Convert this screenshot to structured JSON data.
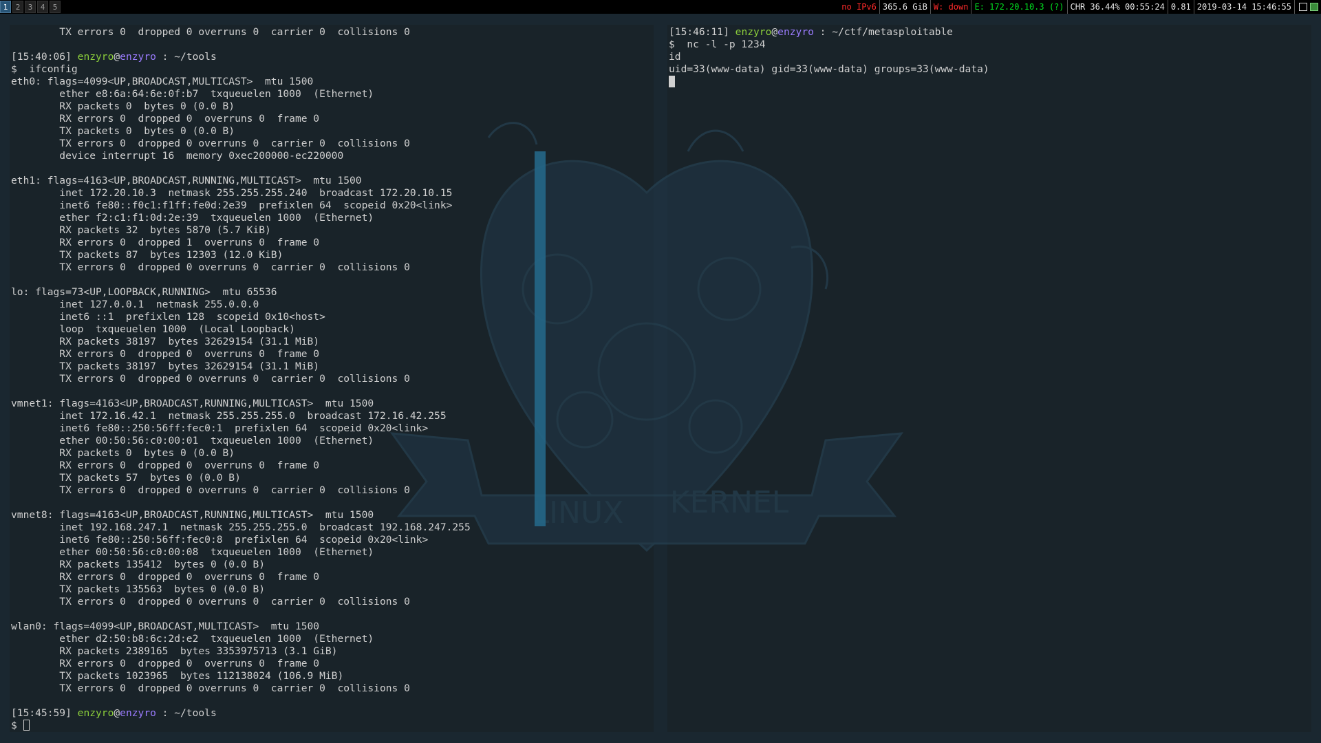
{
  "taskbar": {
    "workspaces": [
      "1",
      "2",
      "3",
      "4",
      "5"
    ],
    "active_workspace": "1",
    "status": {
      "ipv6": "no IPv6",
      "disk": "365.6 GiB",
      "wifi": "W: down",
      "ethernet": "E: 172.20.10.3 (?)",
      "battery": "CHR 36.44% 00:55:24",
      "load": "0.81",
      "datetime": "2019-03-14 15:46:55"
    },
    "colors": {
      "red": "#ff2a2a",
      "green": "#00e020"
    }
  },
  "left_terminal": {
    "lines": [
      "        TX errors 0  dropped 0 overruns 0  carrier 0  collisions 0",
      "",
      "[15:40:06] {u}enzyro{/u}@{h}enzyro{/h} : ~/tools",
      "$  ifconfig",
      "eth0: flags=4099<UP,BROADCAST,MULTICAST>  mtu 1500",
      "        ether e8:6a:64:6e:0f:b7  txqueuelen 1000  (Ethernet)",
      "        RX packets 0  bytes 0 (0.0 B)",
      "        RX errors 0  dropped 0  overruns 0  frame 0",
      "        TX packets 0  bytes 0 (0.0 B)",
      "        TX errors 0  dropped 0 overruns 0  carrier 0  collisions 0",
      "        device interrupt 16  memory 0xec200000-ec220000",
      "",
      "eth1: flags=4163<UP,BROADCAST,RUNNING,MULTICAST>  mtu 1500",
      "        inet 172.20.10.3  netmask 255.255.255.240  broadcast 172.20.10.15",
      "        inet6 fe80::f0c1:f1ff:fe0d:2e39  prefixlen 64  scopeid 0x20<link>",
      "        ether f2:c1:f1:0d:2e:39  txqueuelen 1000  (Ethernet)",
      "        RX packets 32  bytes 5870 (5.7 KiB)",
      "        RX errors 0  dropped 1  overruns 0  frame 0",
      "        TX packets 87  bytes 12303 (12.0 KiB)",
      "        TX errors 0  dropped 0 overruns 0  carrier 0  collisions 0",
      "",
      "lo: flags=73<UP,LOOPBACK,RUNNING>  mtu 65536",
      "        inet 127.0.0.1  netmask 255.0.0.0",
      "        inet6 ::1  prefixlen 128  scopeid 0x10<host>",
      "        loop  txqueuelen 1000  (Local Loopback)",
      "        RX packets 38197  bytes 32629154 (31.1 MiB)",
      "        RX errors 0  dropped 0  overruns 0  frame 0",
      "        TX packets 38197  bytes 32629154 (31.1 MiB)",
      "        TX errors 0  dropped 0 overruns 0  carrier 0  collisions 0",
      "",
      "vmnet1: flags=4163<UP,BROADCAST,RUNNING,MULTICAST>  mtu 1500",
      "        inet 172.16.42.1  netmask 255.255.255.0  broadcast 172.16.42.255",
      "        inet6 fe80::250:56ff:fec0:1  prefixlen 64  scopeid 0x20<link>",
      "        ether 00:50:56:c0:00:01  txqueuelen 1000  (Ethernet)",
      "        RX packets 0  bytes 0 (0.0 B)",
      "        RX errors 0  dropped 0  overruns 0  frame 0",
      "        TX packets 57  bytes 0 (0.0 B)",
      "        TX errors 0  dropped 0 overruns 0  carrier 0  collisions 0",
      "",
      "vmnet8: flags=4163<UP,BROADCAST,RUNNING,MULTICAST>  mtu 1500",
      "        inet 192.168.247.1  netmask 255.255.255.0  broadcast 192.168.247.255",
      "        inet6 fe80::250:56ff:fec0:8  prefixlen 64  scopeid 0x20<link>",
      "        ether 00:50:56:c0:00:08  txqueuelen 1000  (Ethernet)",
      "        RX packets 135412  bytes 0 (0.0 B)",
      "        RX errors 0  dropped 0  overruns 0  frame 0",
      "        TX packets 135563  bytes 0 (0.0 B)",
      "        TX errors 0  dropped 0 overruns 0  carrier 0  collisions 0",
      "",
      "wlan0: flags=4099<UP,BROADCAST,MULTICAST>  mtu 1500",
      "        ether d2:50:b8:6c:2d:e2  txqueuelen 1000  (Ethernet)",
      "        RX packets 2389165  bytes 3353975713 (3.1 GiB)",
      "        RX errors 0  dropped 0  overruns 0  frame 0",
      "        TX packets 1023965  bytes 112138024 (106.9 MiB)",
      "        TX errors 0  dropped 0 overruns 0  carrier 0  collisions 0",
      "",
      "[15:45:59] {u}enzyro{/u}@{h}enzyro{/h} : ~/tools",
      "$ {cursor}"
    ]
  },
  "right_terminal": {
    "lines": [
      "[15:46:11] {u}enzyro{/u}@{h}enzyro{/h} : ~/ctf/metasploitable",
      "$  nc -l -p 1234",
      "id",
      "uid=33(www-data) gid=33(www-data) groups=33(www-data)",
      "{block}"
    ]
  },
  "wallpaper": {
    "left_word": "LINUX",
    "right_word": "KERNEL",
    "accent": "#2e9fd6",
    "tint": "#2a4a5e"
  }
}
